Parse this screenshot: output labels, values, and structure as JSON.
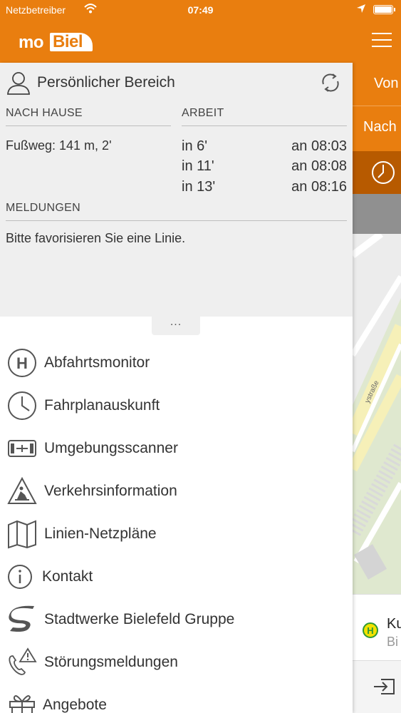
{
  "status": {
    "carrier": "Netzbetreiber",
    "time": "07:49"
  },
  "header": {
    "logo_mo": "mo",
    "logo_biel": "Biel"
  },
  "personal": {
    "title": "Persönlicher Bereich",
    "home": {
      "heading": "NACH HAUSE",
      "walk": "Fußweg: 141 m, 2'"
    },
    "work": {
      "heading": "ARBEIT",
      "departures": [
        {
          "in": "in 6'",
          "at": "an 08:03"
        },
        {
          "in": "in 11'",
          "at": "an 08:08"
        },
        {
          "in": "in 13'",
          "at": "an 08:16"
        }
      ]
    },
    "messages": {
      "heading": "MELDUNGEN",
      "text": "Bitte favorisieren Sie eine Linie."
    },
    "handle": "..."
  },
  "menu": [
    {
      "label": "Abfahrtsmonitor",
      "icon": "h-stop-icon"
    },
    {
      "label": "Fahrplanauskunft",
      "icon": "clock-icon"
    },
    {
      "label": "Umgebungsscanner",
      "icon": "scanner-icon"
    },
    {
      "label": "Verkehrsinformation",
      "icon": "roadwork-icon"
    },
    {
      "label": "Linien-Netzpläne",
      "icon": "map-icon"
    },
    {
      "label": "Kontakt",
      "icon": "info-icon"
    },
    {
      "label": "Stadtwerke Bielefeld Gruppe",
      "icon": "stadtwerke-logo-icon"
    },
    {
      "label": "Störungsmeldungen",
      "icon": "phone-warning-icon"
    },
    {
      "label": "Angebote",
      "icon": "gift-icon"
    }
  ],
  "right_panel": {
    "from": "Von",
    "to": "Nach",
    "stop_name": "Ku",
    "stop_city": "Bi",
    "map_street": "...ystraße"
  },
  "colors": {
    "brand": "#e97e0f",
    "brand_dark": "#b75a00",
    "panel": "#efefef"
  }
}
